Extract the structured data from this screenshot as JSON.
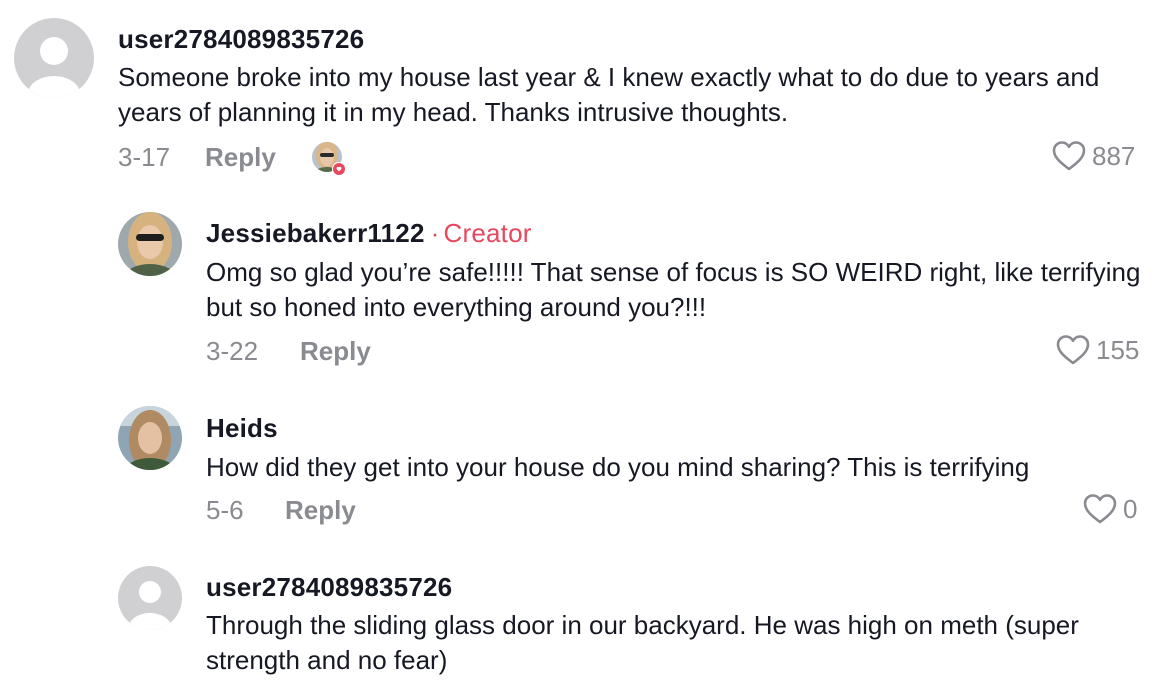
{
  "comments": [
    {
      "username": "user2784089835726",
      "text": "Someone broke into my house last year & I knew exactly what to do due to years and years of planning it in my head. Thanks intrusive thoughts.",
      "date": "3-17",
      "reply_label": "Reply",
      "likes": "887"
    },
    {
      "username": "Jessiebakerr1122",
      "separator": "·",
      "badge": "Creator",
      "text": "Omg so glad you’re safe!!!!! That sense of focus is SO WEIRD right, like terrifying but so honed into everything around you?!!!",
      "date": "3-22",
      "reply_label": "Reply",
      "likes": "155"
    },
    {
      "username": "Heids",
      "text": "How did they get into your house do you mind sharing? This is terrifying",
      "date": "5-6",
      "reply_label": "Reply",
      "likes": "0"
    },
    {
      "username": "user2784089835726",
      "text": "Through the sliding glass door in our backyard. He was high on meth (super strength and no fear)"
    }
  ],
  "icons": {
    "like": "heart-outline-icon",
    "liked_by_creator": "creator-liked-avatar-icon",
    "default_avatar": "default-avatar-icon"
  },
  "colors": {
    "accent": "#e8485e",
    "meta": "#8a8b91",
    "text": "#161823",
    "avatar_bg": "#d0d0d3"
  }
}
